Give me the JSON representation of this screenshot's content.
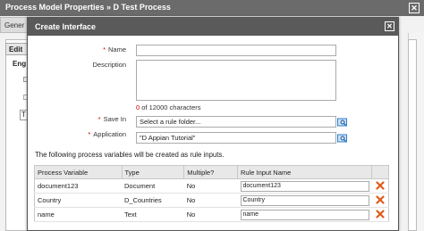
{
  "background": {
    "title": "Process Model Properties » D Test Process",
    "close_label": "✕",
    "tab_label": "Gener",
    "edit_label": "Edit",
    "eng_label": "Eng",
    "small_box_text": "T"
  },
  "dialog": {
    "title": "Create Interface",
    "close_label": "✕",
    "name": {
      "label": "Name",
      "value": ""
    },
    "description": {
      "label": "Description",
      "value": ""
    },
    "counter": {
      "count": "0",
      "text": " of 12000 characters"
    },
    "save_in": {
      "label": "Save In",
      "value": "Select a rule folder..."
    },
    "application": {
      "label": "Application",
      "value": "\"D Appian Tutorial\""
    },
    "info_text": "The following process variables will be created as rule inputs.",
    "table": {
      "headers": [
        "Process Variable",
        "Type",
        "Multiple?",
        "Rule Input Name"
      ],
      "rows": [
        {
          "variable": "document123",
          "type": "Document",
          "multiple": "No",
          "input_name": "document123"
        },
        {
          "variable": "Country",
          "type": "D_Countries",
          "multiple": "No",
          "input_name": "Country"
        },
        {
          "variable": "name",
          "type": "Text",
          "multiple": "No",
          "input_name": "name"
        }
      ]
    }
  },
  "colors": {
    "titlebar": "#5a5a5a",
    "required": "#cc0000",
    "delete": "#e05a1c",
    "lookup": "#2a7fd0"
  },
  "icons": {
    "lookup": "lookup-icon",
    "delete": "delete-icon",
    "close": "close-icon"
  }
}
